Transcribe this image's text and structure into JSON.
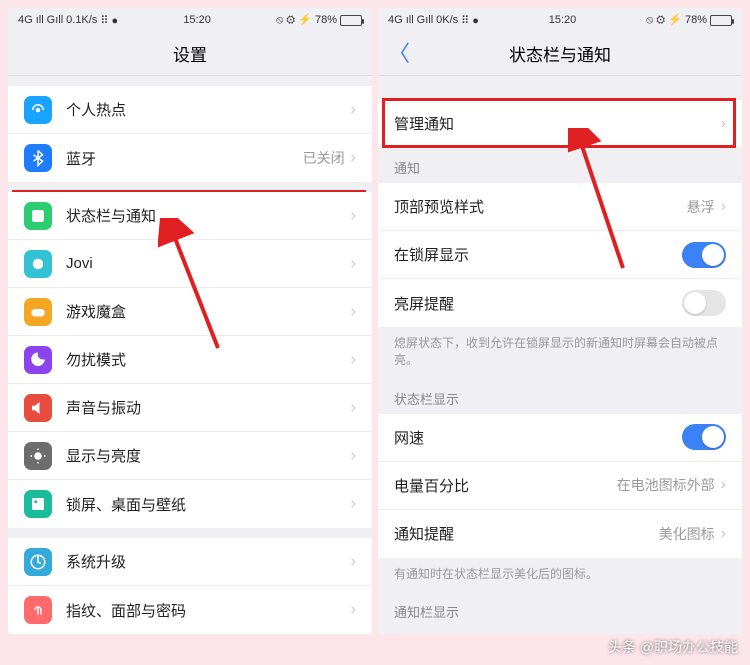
{
  "status": {
    "net_left": "4G",
    "sig": "ıll",
    "sig2": "Gıll",
    "speed_left": "0.1K/s",
    "speed_right": "0K/s",
    "dots": "⠿ ●",
    "time": "15:20",
    "icons_right": "⦸ ⚙ ⚡",
    "battery": "78%"
  },
  "left": {
    "title": "设置",
    "rows": [
      {
        "icon": "hotspot",
        "color": "#1aa3ff",
        "label": "个人热点",
        "value": "",
        "chevron": true
      },
      {
        "icon": "bluetooth",
        "color": "#1e7cff",
        "label": "蓝牙",
        "value": "已关闭",
        "chevron": true
      }
    ],
    "rows2": [
      {
        "icon": "statusbar",
        "color": "#2ecc71",
        "label": "状态栏与通知",
        "value": "",
        "chevron": true,
        "hl": true
      },
      {
        "icon": "jovi",
        "color": "#33c1d6",
        "label": "Jovi",
        "value": "",
        "chevron": true
      },
      {
        "icon": "gamebox",
        "color": "#f5a623",
        "label": "游戏魔盒",
        "value": "",
        "chevron": true
      },
      {
        "icon": "dnd",
        "color": "#8e44ec",
        "label": "勿扰模式",
        "value": "",
        "chevron": true
      },
      {
        "icon": "sound",
        "color": "#e74c3c",
        "label": "声音与振动",
        "value": "",
        "chevron": true
      },
      {
        "icon": "display",
        "color": "#6d6d6d",
        "label": "显示与亮度",
        "value": "",
        "chevron": true
      },
      {
        "icon": "wallpaper",
        "color": "#1abc9c",
        "label": "锁屏、桌面与壁纸",
        "value": "",
        "chevron": true
      }
    ],
    "rows3": [
      {
        "icon": "update",
        "color": "#34aadc",
        "label": "系统升级",
        "value": "",
        "chevron": true
      },
      {
        "icon": "biometric",
        "color": "#ff6b6b",
        "label": "指纹、面部与密码",
        "value": "",
        "chevron": true
      }
    ]
  },
  "right": {
    "title": "状态栏与通知",
    "manage": "管理通知",
    "sec_notif": "通知",
    "rows_notif": [
      {
        "label": "顶部预览样式",
        "value": "悬浮",
        "chevron": true
      },
      {
        "label": "在锁屏显示",
        "toggle": "on"
      },
      {
        "label": "亮屏提醒",
        "toggle": "off"
      }
    ],
    "footer_notif": "熄屏状态下，收到允许在锁屏显示的新通知时屏幕会自动被点亮。",
    "sec_status": "状态栏显示",
    "rows_status": [
      {
        "label": "网速",
        "toggle": "on"
      },
      {
        "label": "电量百分比",
        "value": "在电池图标外部",
        "chevron": true
      },
      {
        "label": "通知提醒",
        "value": "美化图标",
        "chevron": true
      }
    ],
    "footer_status": "有通知时在状态栏显示美化后的图标。",
    "sec_last": "通知栏显示"
  },
  "watermark": "头条 @职场办公技能"
}
